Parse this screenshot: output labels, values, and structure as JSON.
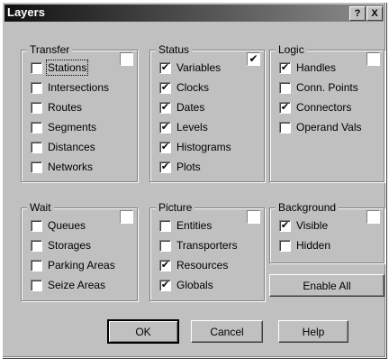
{
  "dialog": {
    "title": "Layers",
    "help_glyph": "?",
    "close_glyph": "X"
  },
  "groups": {
    "transfer": {
      "label": "Transfer",
      "items": [
        {
          "label": "Stations",
          "checked": false
        },
        {
          "label": "Intersections",
          "checked": false
        },
        {
          "label": "Routes",
          "checked": false
        },
        {
          "label": "Segments",
          "checked": false
        },
        {
          "label": "Distances",
          "checked": false
        },
        {
          "label": "Networks",
          "checked": false
        }
      ],
      "group_checked": false
    },
    "status": {
      "label": "Status",
      "items": [
        {
          "label": "Variables",
          "checked": true
        },
        {
          "label": "Clocks",
          "checked": true
        },
        {
          "label": "Dates",
          "checked": true
        },
        {
          "label": "Levels",
          "checked": true
        },
        {
          "label": "Histograms",
          "checked": true
        },
        {
          "label": "Plots",
          "checked": true
        }
      ],
      "group_checked": true
    },
    "logic": {
      "label": "Logic",
      "items": [
        {
          "label": "Handles",
          "checked": true
        },
        {
          "label": "Conn. Points",
          "checked": false
        },
        {
          "label": "Connectors",
          "checked": true
        },
        {
          "label": "Operand Vals",
          "checked": false
        }
      ],
      "group_checked": false
    },
    "wait": {
      "label": "Wait",
      "items": [
        {
          "label": "Queues",
          "checked": false
        },
        {
          "label": "Storages",
          "checked": false
        },
        {
          "label": "Parking Areas",
          "checked": false
        },
        {
          "label": "Seize Areas",
          "checked": false
        }
      ],
      "group_checked": false
    },
    "picture": {
      "label": "Picture",
      "items": [
        {
          "label": "Entities",
          "checked": false
        },
        {
          "label": "Transporters",
          "checked": false
        },
        {
          "label": "Resources",
          "checked": true
        },
        {
          "label": "Globals",
          "checked": true
        }
      ],
      "group_checked": false
    },
    "background": {
      "label": "Background",
      "items": [
        {
          "label": "Visible",
          "checked": true
        },
        {
          "label": "Hidden",
          "checked": false
        }
      ],
      "group_checked": false
    }
  },
  "buttons": {
    "enable_all": "Enable All",
    "ok": "OK",
    "cancel": "Cancel",
    "help": "Help"
  },
  "check_glyph": "✔"
}
